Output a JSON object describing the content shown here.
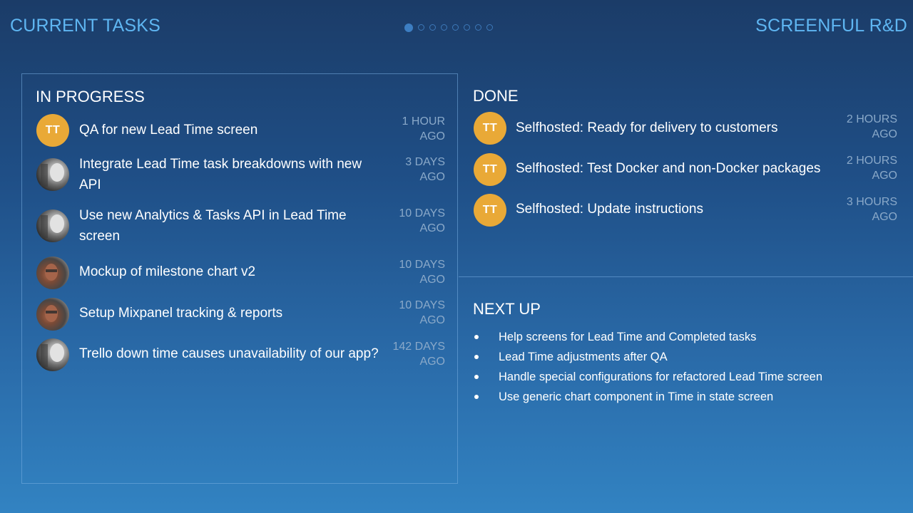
{
  "header": {
    "left_title": "CURRENT TASKS",
    "right_title": "SCREENFUL R&D",
    "pager": {
      "total": 8,
      "active": 1
    }
  },
  "in_progress": {
    "title": "IN PROGRESS",
    "tasks": [
      {
        "title": "QA for new Lead Time screen",
        "time_line1": "1 HOUR",
        "time_line2": "AGO",
        "avatar": "initials",
        "initials": "TT"
      },
      {
        "title": "Integrate Lead Time task breakdowns with new API",
        "time_line1": "3 DAYS",
        "time_line2": "AGO",
        "avatar": "photo-a"
      },
      {
        "title": "Use new Analytics & Tasks API in Lead Time screen",
        "time_line1": "10 DAYS",
        "time_line2": "AGO",
        "avatar": "photo-a"
      },
      {
        "title": "Mockup of milestone chart v2",
        "time_line1": "10 DAYS",
        "time_line2": "AGO",
        "avatar": "photo-b"
      },
      {
        "title": "Setup Mixpanel tracking & reports",
        "time_line1": "10 DAYS",
        "time_line2": "AGO",
        "avatar": "photo-b"
      },
      {
        "title": "Trello down time causes unavailability of our app?",
        "time_line1": "142 DAYS",
        "time_line2": "AGO",
        "avatar": "photo-a"
      }
    ]
  },
  "done": {
    "title": "DONE",
    "tasks": [
      {
        "title": "Selfhosted: Ready for delivery to customers",
        "time_line1": "2 HOURS",
        "time_line2": "AGO",
        "avatar": "initials",
        "initials": "TT"
      },
      {
        "title": "Selfhosted: Test Docker and non-Docker packages",
        "time_line1": "2 HOURS",
        "time_line2": "AGO",
        "avatar": "initials",
        "initials": "TT"
      },
      {
        "title": "Selfhosted: Update instructions",
        "time_line1": "3 HOURS",
        "time_line2": "AGO",
        "avatar": "initials",
        "initials": "TT"
      }
    ]
  },
  "next_up": {
    "title": "NEXT UP",
    "items": [
      "Help screens for Lead Time and Completed tasks",
      "Lead Time adjustments after QA",
      "Handle special configurations for refactored Lead Time screen",
      "Use generic chart component in Time in state screen"
    ]
  },
  "colors": {
    "accent": "#5fb6f2",
    "avatar_initials_bg": "#e9a937",
    "time_text": "#8aa9c9"
  }
}
